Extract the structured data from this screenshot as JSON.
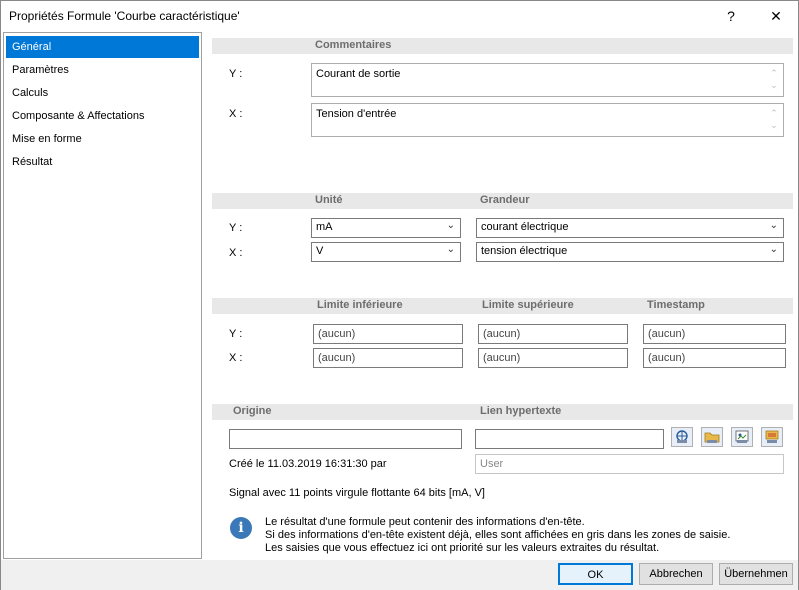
{
  "window": {
    "title": "Propriétés Formule 'Courbe caractéristique'",
    "help_label": "?",
    "close_label": "✕"
  },
  "sidebar": {
    "items": [
      {
        "label": "Général"
      },
      {
        "label": "Paramètres"
      },
      {
        "label": "Calculs"
      },
      {
        "label": "Composante & Affectations"
      },
      {
        "label": "Mise en forme"
      },
      {
        "label": "Résultat"
      }
    ]
  },
  "comments": {
    "header": "Commentaires",
    "y_label": "Y :",
    "x_label": "X :",
    "y_value": "Courant de sortie",
    "x_value": "Tension d'entrée"
  },
  "units": {
    "unit_header": "Unité",
    "quantity_header": "Grandeur",
    "y_label": "Y :",
    "x_label": "X :",
    "y_unit": "mA",
    "x_unit": "V",
    "y_quantity": "courant électrique",
    "x_quantity": "tension électrique"
  },
  "limits": {
    "lower_header": "Limite inférieure",
    "upper_header": "Limite supérieure",
    "timestamp_header": "Timestamp",
    "y_label": "Y :",
    "x_label": "X :",
    "y_lower": "(aucun)",
    "y_upper": "(aucun)",
    "y_timestamp": "(aucun)",
    "x_lower": "(aucun)",
    "x_upper": "(aucun)",
    "x_timestamp": "(aucun)"
  },
  "origin": {
    "header": "Origine",
    "link_header": "Lien hypertexte",
    "origin_value": "",
    "link_value": "",
    "created_text": "Créé le 11.03.2019 16:31:30 par",
    "user_placeholder": "User",
    "icons": [
      "link-web-icon",
      "link-folder-icon",
      "link-file-icon",
      "link-remove-icon"
    ]
  },
  "signal_text": "Signal avec 11 points virgule flottante 64 bits [mA, V]",
  "info": {
    "icon": "info-icon",
    "line1": "Le résultat d'une formule peut contenir des informations d'en-tête.",
    "line2": "Si des informations d'en-tête existent déjà, elles sont affichées en gris dans les zones de saisie.",
    "line3": "Les saisies que vous effectuez ici ont priorité sur les valeurs extraites du résultat."
  },
  "buttons": {
    "ok": "OK",
    "cancel": "Abbrechen",
    "apply": "Übernehmen"
  }
}
